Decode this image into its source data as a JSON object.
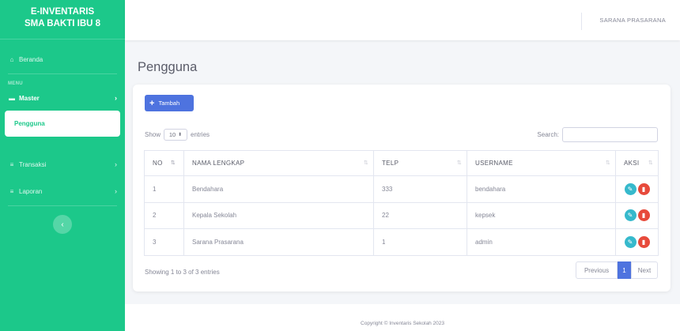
{
  "sidebar": {
    "brand_line1": "E-INVENTARIS",
    "brand_line2": "SMA BAKTI IBU 8",
    "beranda_label": "Beranda",
    "menu_heading": "MENU",
    "master_label": "Master",
    "pengguna_label": "Pengguna",
    "transaksi_label": "Transaksi",
    "laporan_label": "Laporan"
  },
  "topbar": {
    "user_name": "SARANA PRASARANA"
  },
  "page": {
    "title": "Pengguna"
  },
  "toolbar": {
    "add_label": "Tambah"
  },
  "datatable": {
    "show_label": "Show",
    "entries_value": "10",
    "entries_label": "entries",
    "search_label": "Search:",
    "columns": [
      "NO",
      "NAMA LENGKAP",
      "TELP",
      "USERNAME",
      "AKSI"
    ],
    "rows": [
      {
        "no": "1",
        "nama": "Bendahara",
        "telp": "333",
        "username": "bendahara"
      },
      {
        "no": "2",
        "nama": "Kepala Sekolah",
        "telp": "22",
        "username": "kepsek"
      },
      {
        "no": "3",
        "nama": "Sarana Prasarana",
        "telp": "1",
        "username": "admin"
      }
    ],
    "info": "Showing 1 to 3 of 3 entries",
    "pagination": {
      "previous": "Previous",
      "current": "1",
      "next": "Next"
    }
  },
  "footer": {
    "copyright": "Copyright © Inventaris Sekolah 2023"
  },
  "colors": {
    "sidebar": "#1cc88a",
    "primary": "#4e73df",
    "edit": "#36b9cc",
    "delete": "#e74a3b"
  },
  "icons": {
    "beranda": "home-icon",
    "master": "folder-icon",
    "edit": "edit-icon",
    "delete": "trash-icon"
  }
}
